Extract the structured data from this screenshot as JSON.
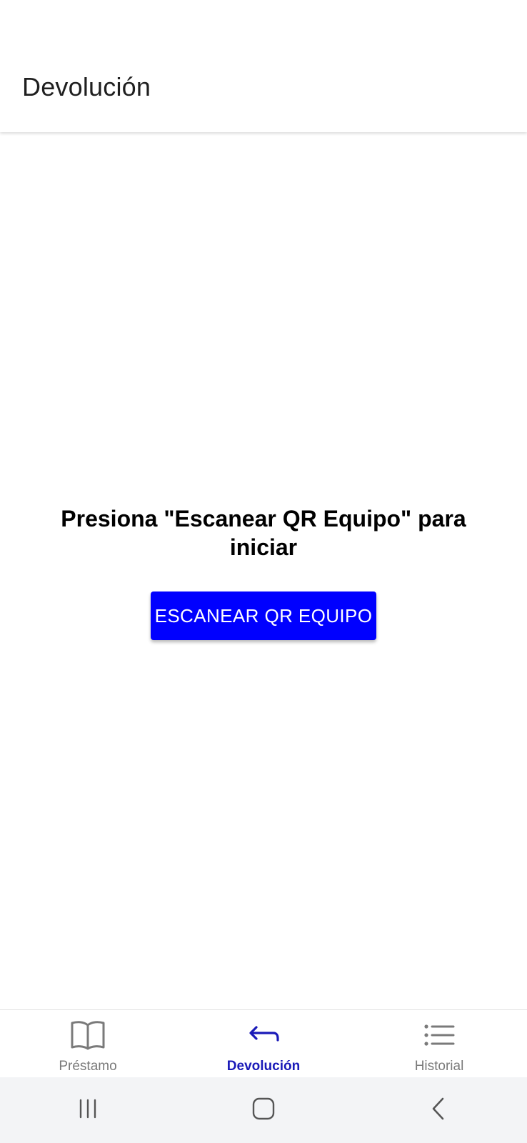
{
  "app_bar": {
    "title": "Devolución"
  },
  "main": {
    "instruction": "Presiona \"Escanear QR Equipo\" para iniciar",
    "scan_button_label": "ESCANEAR QR EQUIPO"
  },
  "tabs": [
    {
      "label": "Préstamo",
      "icon": "book-open-icon",
      "active": false
    },
    {
      "label": "Devolución",
      "icon": "return-arrow-icon",
      "active": true
    },
    {
      "label": "Historial",
      "icon": "list-icon",
      "active": false
    }
  ],
  "system_nav": {
    "buttons": [
      "recent-apps-icon",
      "home-icon",
      "back-icon"
    ]
  },
  "colors": {
    "accent": "#0000ff",
    "active_tab": "#1a1ab8",
    "inactive_tab": "#7a7a7a",
    "nav_background": "#f3f4f6"
  }
}
